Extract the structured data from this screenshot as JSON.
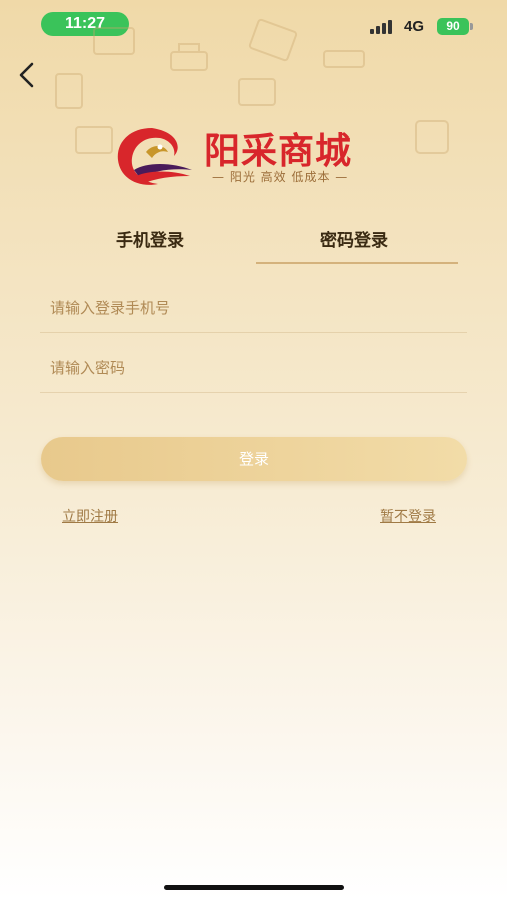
{
  "status_bar": {
    "time": "11:27",
    "network": "4G",
    "battery": "90"
  },
  "brand": {
    "name": "阳采商城",
    "slogan": "— 阳光  高效  低成本 —"
  },
  "tabs": [
    {
      "label": "手机登录"
    },
    {
      "label": "密码登录"
    }
  ],
  "form": {
    "phone_placeholder": "请输入登录手机号",
    "password_placeholder": "请输入密码",
    "login_label": "登录",
    "register_label": "立即注册",
    "skip_label": "暂不登录"
  },
  "colors": {
    "brand_red": "#d8262b",
    "accent_gold": "#d4b27c",
    "status_green": "#3ac35a"
  }
}
